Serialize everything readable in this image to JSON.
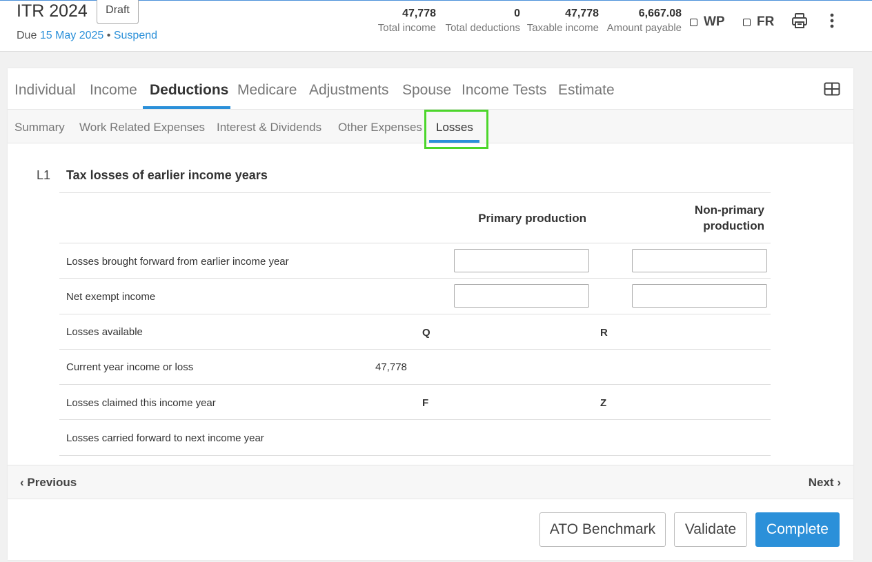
{
  "header": {
    "title": "ITR 2024",
    "status_badge": "Draft",
    "due_prefix": "Due",
    "due_date": "15 May 2025",
    "separator": "•",
    "suspend_link": "Suspend",
    "stats": [
      {
        "value": "47,778",
        "label": "Total income"
      },
      {
        "value": "0",
        "label": "Total deductions"
      },
      {
        "value": "47,778",
        "label": "Taxable income"
      },
      {
        "value": "6,667.08",
        "label": "Amount payable"
      }
    ],
    "checkboxes": [
      {
        "label": "WP",
        "checked": false
      },
      {
        "label": "FR",
        "checked": false
      }
    ],
    "icons": {
      "print": "print-icon",
      "more": "kebab-icon"
    }
  },
  "main_tabs": [
    {
      "label": "Individual"
    },
    {
      "label": "Income"
    },
    {
      "label": "Deductions",
      "active": true
    },
    {
      "label": "Medicare"
    },
    {
      "label": "Adjustments"
    },
    {
      "label": "Spouse"
    },
    {
      "label": "Income Tests"
    },
    {
      "label": "Estimate"
    }
  ],
  "sub_tabs": [
    {
      "label": "Summary"
    },
    {
      "label": "Work Related Expenses"
    },
    {
      "label": "Interest & Dividends"
    },
    {
      "label": "Other Expenses"
    },
    {
      "label": "Losses",
      "active": true
    }
  ],
  "section": {
    "code": "L1",
    "title": "Tax losses of earlier income years",
    "col_primary": "Primary production",
    "col_nonprimary_line1": "Non-primary",
    "col_nonprimary_line2": "production",
    "rows": [
      {
        "label": "Losses brought forward from earlier income year",
        "primary_value": "",
        "nonprimary_value": ""
      },
      {
        "label": "Net exempt income",
        "primary_value": "",
        "nonprimary_value": ""
      },
      {
        "label": "Losses available",
        "primary_letter": "Q",
        "nonprimary_letter": "R"
      },
      {
        "label": "Current year income or loss",
        "value": "47,778"
      },
      {
        "label": "Losses claimed this income year",
        "primary_letter": "F",
        "nonprimary_letter": "Z"
      },
      {
        "label": "Losses carried forward to next income year"
      }
    ]
  },
  "footer": {
    "previous": "Previous",
    "next": "Next",
    "buttons": {
      "ato_benchmark": "ATO Benchmark",
      "validate": "Validate",
      "complete": "Complete"
    }
  },
  "colors": {
    "accent": "#2b90d9",
    "highlight": "#4cd62b"
  }
}
